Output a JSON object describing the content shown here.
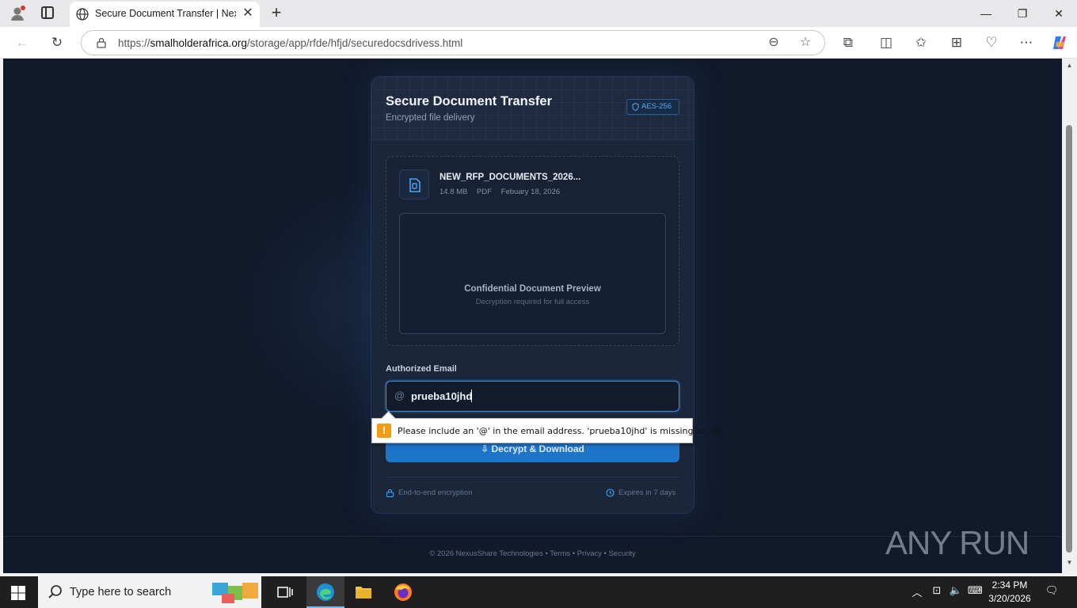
{
  "browser": {
    "tab_title": "Secure Document Transfer | NexusShare",
    "url_domain": "smalholderafrica.org",
    "url_prefix": "https://",
    "url_path": "/storage/app/rfde/hfjd/securedocsdrivess.html"
  },
  "card": {
    "title": "Secure Document Transfer",
    "subtitle": "Encrypted file delivery",
    "badge": "AES-256"
  },
  "document": {
    "name": "NEW_RFP_DOCUMENTS_2026...",
    "size": "14.8 MB",
    "format": "PDF",
    "date": "Febuary 18, 2026",
    "preview_title": "Confidential Document Preview",
    "preview_subtitle": "Decryption required for full access"
  },
  "form": {
    "email_label": "Authorized Email",
    "email_prefix": "@",
    "email_value": "prueba10jhd",
    "button_label": "Decrypt & Download",
    "validation_message": "Please include an '@' in the email address. 'prueba10jhd' is missing an '@'."
  },
  "card_footer": {
    "left": "End-to-end encryption",
    "right": "Expires in 7 days"
  },
  "page_footer": "© 2026 NexusShare Technologies • Terms • Privacy • Security",
  "watermark": "ANY RUN",
  "taskbar": {
    "search_placeholder": "Type here to search",
    "time": "2:34 PM",
    "date": "3/20/2026"
  },
  "colors": {
    "accent": "#1e74c9",
    "page_bg": "#111a2b",
    "card_bg": "#1a2639",
    "badge_text": "#58a9ee",
    "warning": "#f39c12"
  }
}
